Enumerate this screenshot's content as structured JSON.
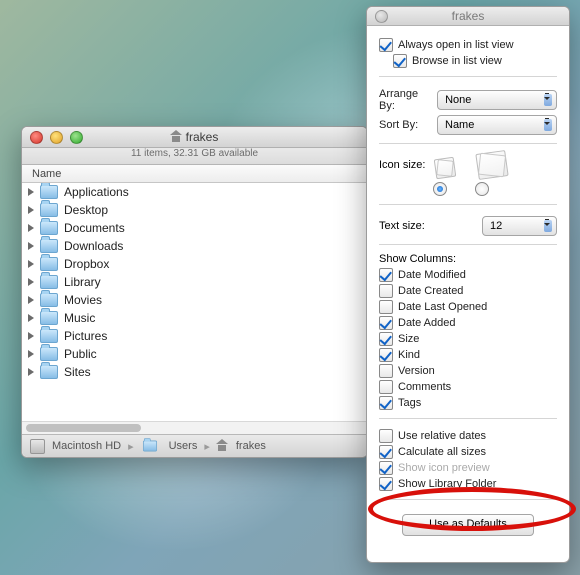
{
  "finder": {
    "title": "frakes",
    "status": "11 items, 32.31 GB available",
    "column_header": "Name",
    "items": [
      {
        "label": "Applications"
      },
      {
        "label": "Desktop"
      },
      {
        "label": "Documents"
      },
      {
        "label": "Downloads"
      },
      {
        "label": "Dropbox"
      },
      {
        "label": "Library"
      },
      {
        "label": "Movies"
      },
      {
        "label": "Music"
      },
      {
        "label": "Pictures"
      },
      {
        "label": "Public"
      },
      {
        "label": "Sites"
      }
    ],
    "path": {
      "hd": "Macintosh HD",
      "users": "Users",
      "home": "frakes"
    }
  },
  "inspector": {
    "title": "frakes",
    "always_open": {
      "label": "Always open in list view",
      "checked": true
    },
    "browse": {
      "label": "Browse in list view",
      "checked": true
    },
    "arrange_label": "Arrange By:",
    "arrange_value": "None",
    "sort_label": "Sort By:",
    "sort_value": "Name",
    "icon_size_label": "Icon size:",
    "icon_size_selected": "small",
    "text_size_label": "Text size:",
    "text_size_value": "12",
    "columns_label": "Show Columns:",
    "columns": [
      {
        "key": "date-modified",
        "label": "Date Modified",
        "checked": true
      },
      {
        "key": "date-created",
        "label": "Date Created",
        "checked": false
      },
      {
        "key": "date-last-opened",
        "label": "Date Last Opened",
        "checked": false
      },
      {
        "key": "date-added",
        "label": "Date Added",
        "checked": true
      },
      {
        "key": "size",
        "label": "Size",
        "checked": true
      },
      {
        "key": "kind",
        "label": "Kind",
        "checked": true
      },
      {
        "key": "version",
        "label": "Version",
        "checked": false
      },
      {
        "key": "comments",
        "label": "Comments",
        "checked": false
      },
      {
        "key": "tags",
        "label": "Tags",
        "checked": true
      }
    ],
    "relative": {
      "label": "Use relative dates",
      "checked": false
    },
    "calc": {
      "label": "Calculate all sizes",
      "checked": true
    },
    "preview": {
      "label": "Show icon preview",
      "checked": true
    },
    "library": {
      "label": "Show Library Folder",
      "checked": true
    },
    "defaults_btn": "Use as Defaults"
  },
  "annotation": {
    "highlight": "Show Library Folder"
  }
}
